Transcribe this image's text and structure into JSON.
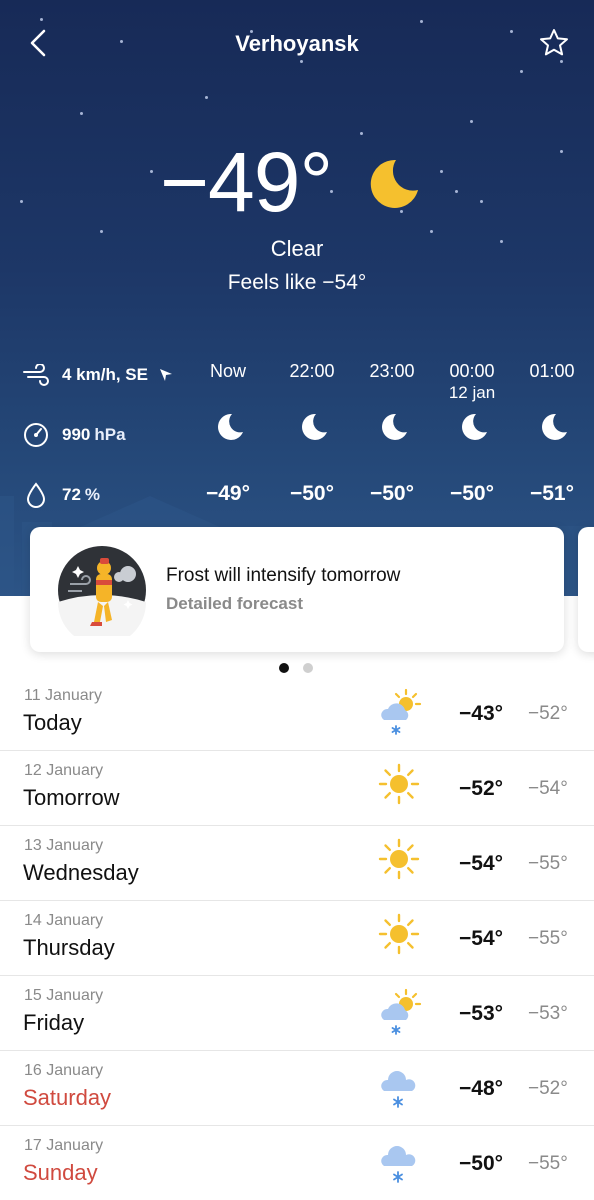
{
  "header": {
    "city": "Verhoyansk"
  },
  "current": {
    "temperature": "−49°",
    "condition": "Clear",
    "feels_like": "Feels like −54°"
  },
  "metrics": {
    "wind": {
      "value": "4 km/h, SE"
    },
    "pressure": {
      "value": "990",
      "unit": "hPa"
    },
    "humidity": {
      "value": "72",
      "unit": "%"
    }
  },
  "hourly": [
    {
      "time": "Now",
      "date": "",
      "temp": "−49°",
      "icon": "moon-icon"
    },
    {
      "time": "22:00",
      "date": "",
      "temp": "−50°",
      "icon": "moon-icon"
    },
    {
      "time": "23:00",
      "date": "",
      "temp": "−50°",
      "icon": "moon-icon"
    },
    {
      "time": "00:00",
      "date": "12 jan",
      "temp": "−50°",
      "icon": "moon-icon"
    },
    {
      "time": "01:00",
      "date": "",
      "temp": "−51°",
      "icon": "moon-icon"
    }
  ],
  "alert_card": {
    "title": "Frost will intensify tomorrow",
    "link": "Detailed forecast"
  },
  "daily": [
    {
      "date": "11 January",
      "day": "Today",
      "hi": "−43°",
      "lo": "−52°",
      "icon": "sun-cloud-snow-icon",
      "weekend": false
    },
    {
      "date": "12 January",
      "day": "Tomorrow",
      "hi": "−52°",
      "lo": "−54°",
      "icon": "sun-icon",
      "weekend": false
    },
    {
      "date": "13 January",
      "day": "Wednesday",
      "hi": "−54°",
      "lo": "−55°",
      "icon": "sun-icon",
      "weekend": false
    },
    {
      "date": "14 January",
      "day": "Thursday",
      "hi": "−54°",
      "lo": "−55°",
      "icon": "sun-icon",
      "weekend": false
    },
    {
      "date": "15 January",
      "day": "Friday",
      "hi": "−53°",
      "lo": "−53°",
      "icon": "sun-cloud-snow-icon",
      "weekend": false
    },
    {
      "date": "16 January",
      "day": "Saturday",
      "hi": "−48°",
      "lo": "−52°",
      "icon": "cloud-snow-icon",
      "weekend": true
    },
    {
      "date": "17 January",
      "day": "Sunday",
      "hi": "−50°",
      "lo": "−55°",
      "icon": "cloud-snow-icon",
      "weekend": true
    }
  ],
  "colors": {
    "sky_top": "#172a57",
    "sky_bottom": "#2c5486",
    "weekend": "#d04a3f",
    "sun": "#f5c02e",
    "cloud": "#a9c7f0"
  }
}
